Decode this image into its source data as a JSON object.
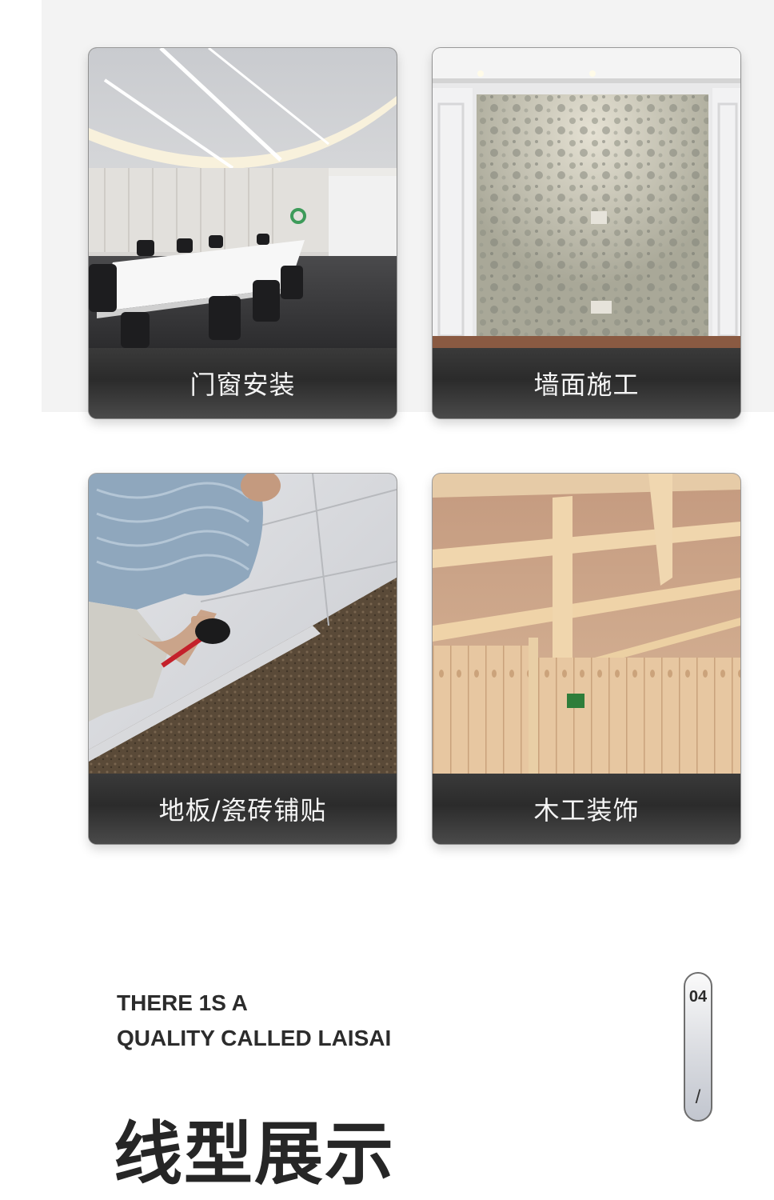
{
  "cards": [
    {
      "label": "门窗安装",
      "image": "meeting-room-photo"
    },
    {
      "label": "墙面施工",
      "image": "wallpaper-wall-photo"
    },
    {
      "label": "地板/瓷砖铺贴",
      "image": "tile-laying-photo"
    },
    {
      "label": "木工装饰",
      "image": "wood-ceiling-photo"
    }
  ],
  "tagline": {
    "line1": "THERE 1S A",
    "line2": "QUALITY CALLED LAISAI"
  },
  "section_title": "线型展示",
  "page_indicator": {
    "current": "04",
    "separator": "/"
  },
  "colors": {
    "label_bar": "#2b2b2b",
    "label_text": "#f4f4f4",
    "title_text": "#262626"
  }
}
